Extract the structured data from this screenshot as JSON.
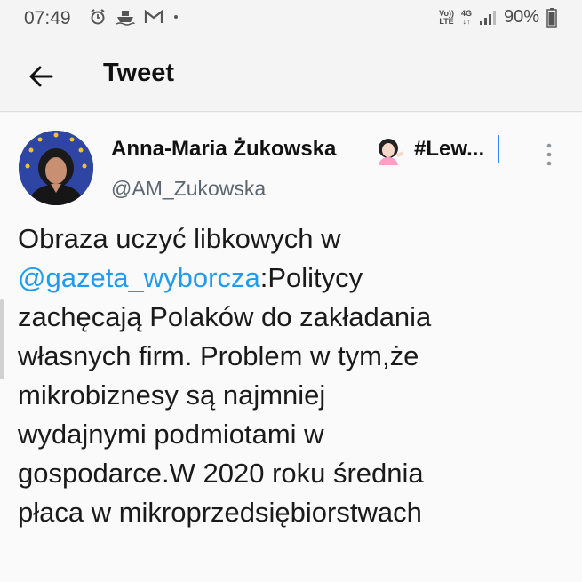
{
  "status_bar": {
    "time": "07:49",
    "lte_top": "Vo))",
    "lte_bottom": "LTE",
    "net_top": "4G",
    "net_bottom": "↓↑",
    "battery": "90%"
  },
  "app_bar": {
    "title": "Tweet",
    "back_icon": "arrow-left-icon"
  },
  "tweet": {
    "author_name": "Anna-Maria Żukowska",
    "author_tag": "#Lew...",
    "handle": "@AM_Zukowska",
    "text_lines": [
      {
        "parts": [
          {
            "text": "Obraza uczyć libkowych w",
            "mention": false
          }
        ]
      },
      {
        "parts": [
          {
            "text": "@gazeta_wyborcza",
            "mention": true
          },
          {
            "text": ":Politycy",
            "mention": false
          }
        ]
      },
      {
        "parts": [
          {
            "text": "zachęcają Polaków do zakładania",
            "mention": false
          }
        ]
      },
      {
        "parts": [
          {
            "text": "własnych firm. Problem w tym,że",
            "mention": false
          }
        ]
      },
      {
        "parts": [
          {
            "text": "mikrobiznesy są najmniej",
            "mention": false
          }
        ]
      },
      {
        "parts": [
          {
            "text": "wydajnymi podmiotami w",
            "mention": false
          }
        ]
      },
      {
        "parts": [
          {
            "text": "gospodarce.W 2020 roku średnia",
            "mention": false
          }
        ]
      },
      {
        "parts": [
          {
            "text": "płaca w mikroprzedsiębiorstwach",
            "mention": false
          }
        ]
      }
    ]
  },
  "colors": {
    "mention": "#1d9bf0",
    "background": "#fafafa",
    "text": "#1a1a1a",
    "handle": "#5b6670"
  }
}
